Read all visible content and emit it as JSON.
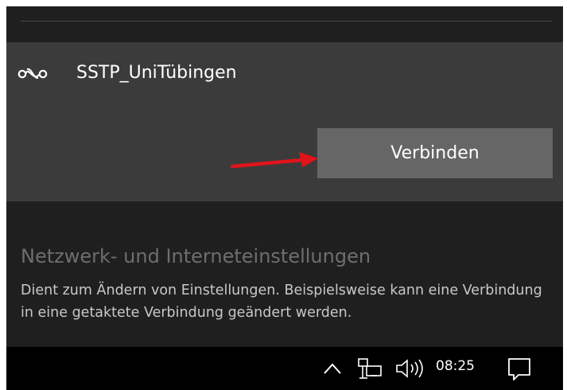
{
  "vpn": {
    "name": "SSTP_UniTübingen",
    "icon": "vpn-link-icon",
    "connect_label": "Verbinden"
  },
  "annotation": {
    "arrow_color": "#e0141a"
  },
  "settings": {
    "title": "Netzwerk- und Interneteinstellungen",
    "description": "Dient zum Ändern von Einstellungen. Beispielsweise kann eine Verbindung in eine getaktete Verbindung geändert werden."
  },
  "taskbar": {
    "clock": "08:25",
    "icons": [
      "chevron-up-icon",
      "network-icon",
      "volume-icon",
      "action-center-icon"
    ]
  },
  "colors": {
    "flyout_bg": "#1f1f1f",
    "panel_bg": "#3b3b3b",
    "button_bg": "#666666",
    "taskbar_bg": "#000000"
  }
}
